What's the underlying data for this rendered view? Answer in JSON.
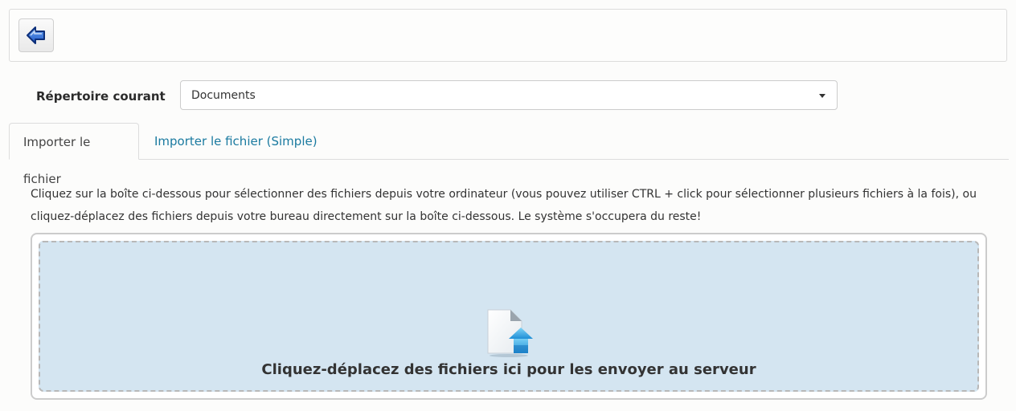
{
  "toolbar": {
    "back_icon": "arrow-left-icon"
  },
  "directory": {
    "label": "Répertoire courant",
    "selected": "Documents"
  },
  "tabs": [
    {
      "label": "Importer le fichier",
      "active": true
    },
    {
      "label": "Importer le fichier (Simple)",
      "active": false
    }
  ],
  "instructions": "Cliquez sur la boîte ci-dessous pour sélectionner des fichiers depuis votre ordinateur (vous pouvez utiliser CTRL + click pour sélectionner plusieurs fichiers à la fois), ou cliquez-déplacez des fichiers depuis votre bureau directement sur la boîte ci-dessous. Le système s'occupera du reste!",
  "dropzone": {
    "text": "Cliquez-déplacez des fichiers ici pour les envoyer au serveur",
    "icon": "file-upload-icon"
  },
  "colors": {
    "link": "#1a7aa0",
    "dropzone_bg": "#d4e5f1"
  }
}
